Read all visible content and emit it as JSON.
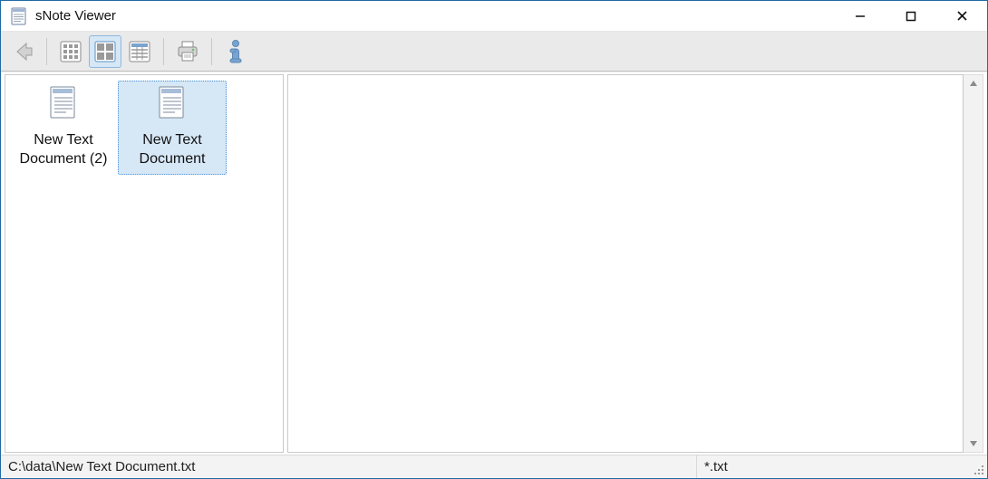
{
  "title": "sNote Viewer",
  "toolbar": {
    "back": "Back",
    "view_small": "Small icons",
    "view_large": "Large icons",
    "view_list": "List view",
    "print": "Print",
    "info": "Info"
  },
  "files": [
    {
      "name": "New Text Document (2)",
      "selected": false
    },
    {
      "name": "New Text Document",
      "selected": true
    }
  ],
  "status": {
    "path": "C:\\data\\New Text Document.txt",
    "filter": "*.txt"
  }
}
